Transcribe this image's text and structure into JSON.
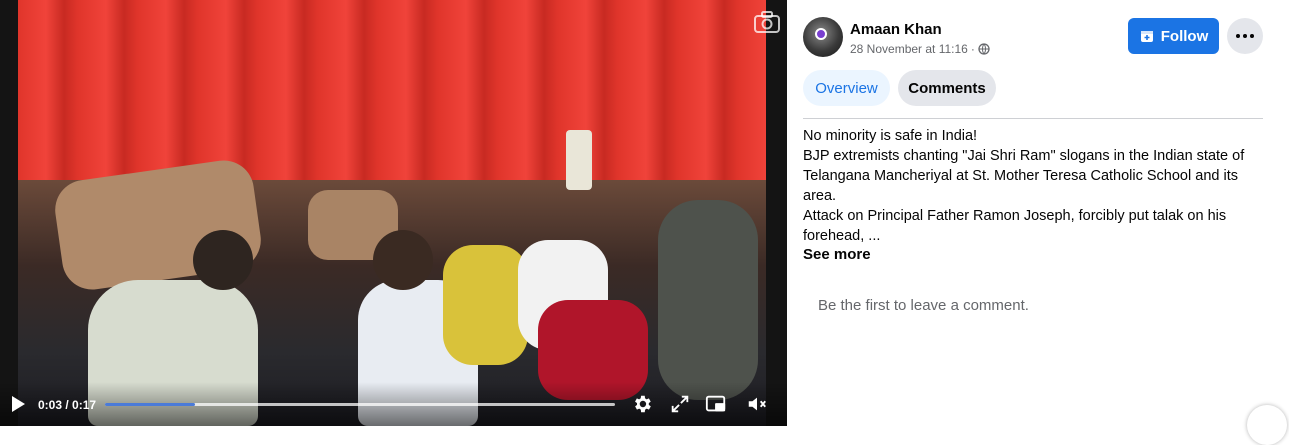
{
  "video": {
    "time_label": "0:03 / 0:17",
    "progress_fraction": 0.176,
    "accent_color": "#4b7bd8"
  },
  "post": {
    "author": "Amaan Khan",
    "timestamp": "28 November at 11:16",
    "separator": "·",
    "privacy_icon": "globe-icon",
    "follow_label": "Follow",
    "follow_color": "#1b74e4"
  },
  "tabs": [
    {
      "label": "Overview",
      "active": true
    },
    {
      "label": "Comments",
      "active": false
    }
  ],
  "caption": {
    "lines": [
      "No minority is safe in India!",
      "BJP extremists chanting \"Jai Shri Ram\" slogans in the Indian state of",
      "Telangana Mancheriyal at St. Mother Teresa Catholic School and its",
      "area.",
      "Attack on Principal Father Ramon Joseph, forcibly put talak on his",
      "forehead, ..."
    ],
    "see_more": "See more"
  },
  "comments": {
    "empty_text": "Be the first to leave a comment."
  }
}
